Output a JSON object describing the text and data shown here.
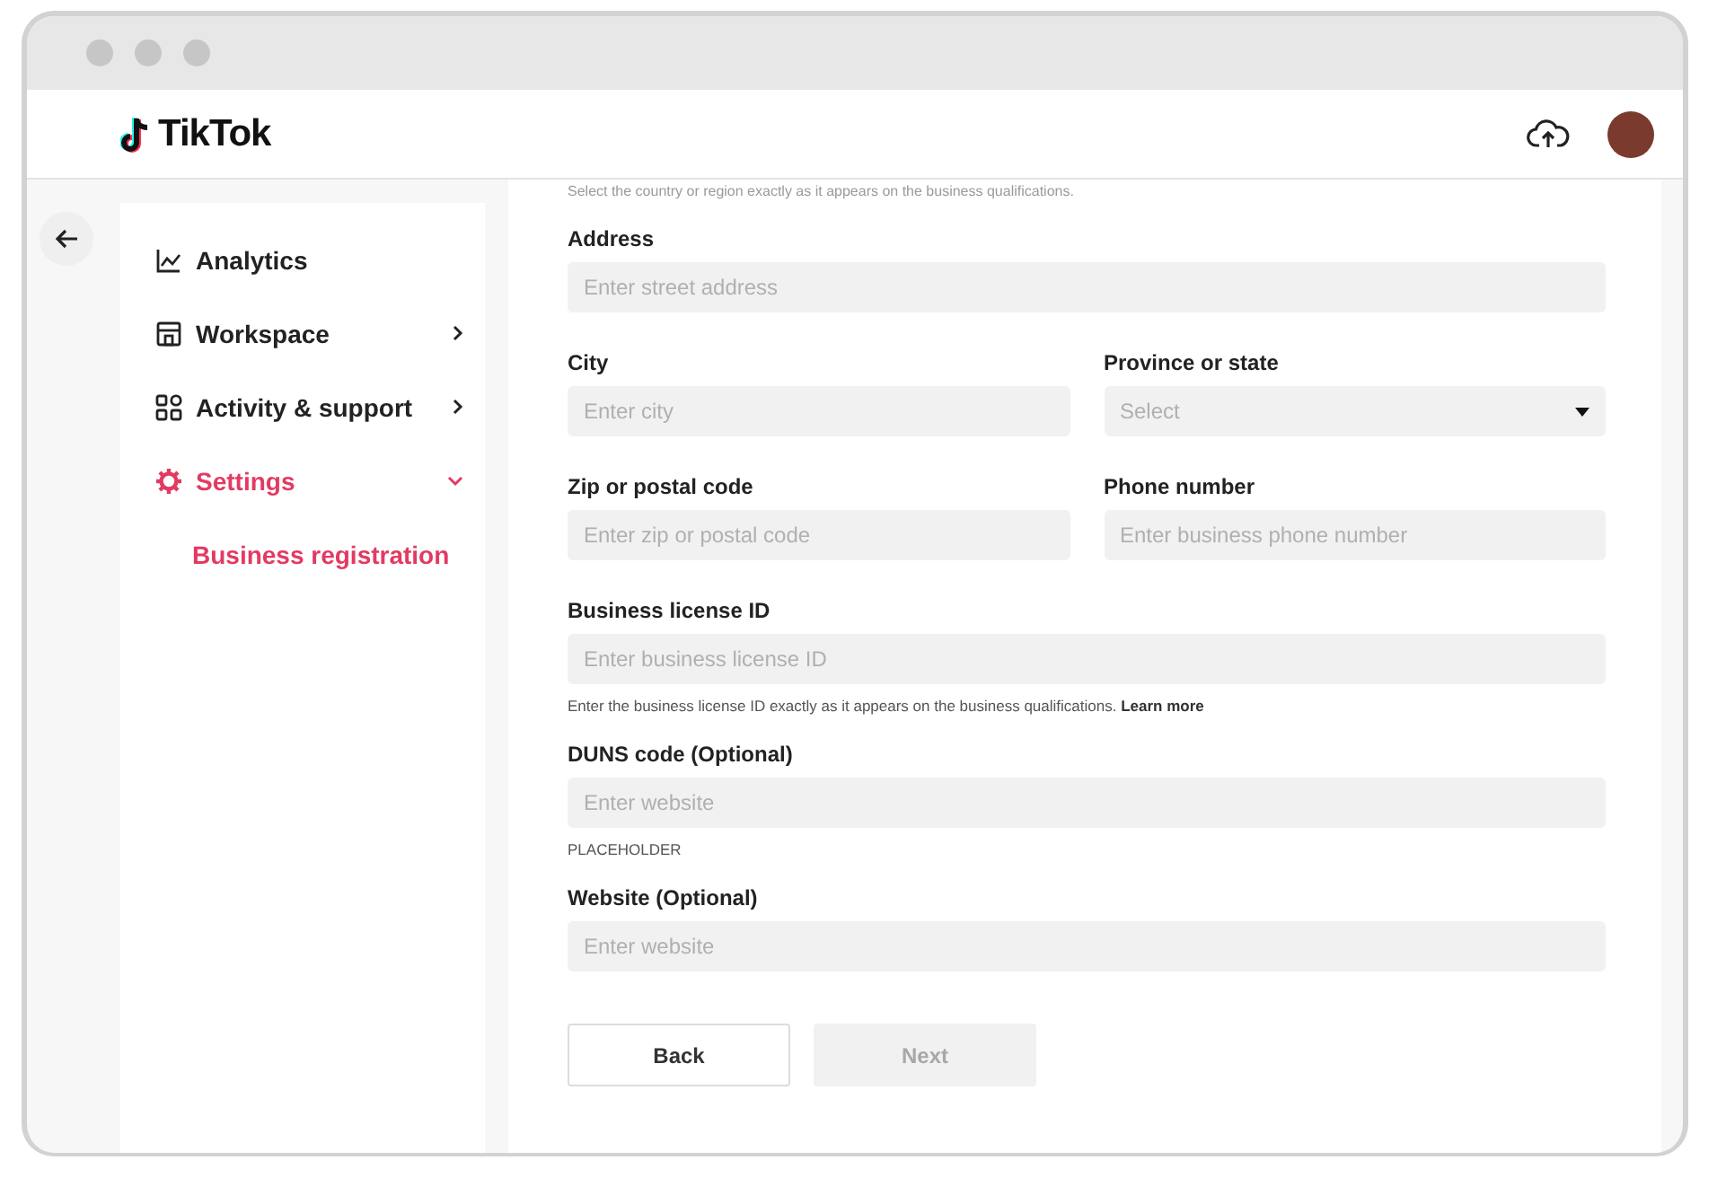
{
  "header": {
    "logo": "TikTok"
  },
  "sidebar": {
    "items": [
      {
        "label": "Analytics",
        "selected": false
      },
      {
        "label": "Workspace",
        "expanded": false,
        "selected": false
      },
      {
        "label": "Activity & support",
        "expanded": false,
        "selected": false
      },
      {
        "label": "Settings",
        "expanded": true,
        "selected": true,
        "children": [
          {
            "label": "Business registration",
            "selected": true
          }
        ]
      }
    ]
  },
  "form": {
    "top_hint": "Select the country or region exactly as it appears on the business qualifications.",
    "rows": [
      {
        "fields": [
          {
            "label": "Address",
            "kind": "text",
            "placeholder": "Enter street address"
          }
        ]
      },
      {
        "fields": [
          {
            "label": "City",
            "kind": "text",
            "placeholder": "Enter city"
          },
          {
            "label": "Province or state",
            "kind": "select",
            "placeholder": "Select"
          }
        ]
      },
      {
        "fields": [
          {
            "label": "Zip or postal code",
            "kind": "text",
            "placeholder": "Enter zip or postal code"
          },
          {
            "label": "Phone number",
            "kind": "text",
            "placeholder": "Enter business phone number"
          }
        ]
      },
      {
        "fields": [
          {
            "label": "Business license ID",
            "kind": "text",
            "placeholder": "Enter business license ID",
            "hint": "Enter the business license ID exactly as it appears on the business qualifications.",
            "hint_link": "Learn more"
          }
        ]
      },
      {
        "fields": [
          {
            "label": "DUNS code (Optional)",
            "kind": "text",
            "placeholder": "Enter website",
            "hint": "PLACEHOLDER"
          }
        ]
      },
      {
        "fields": [
          {
            "label": "Website (Optional)",
            "kind": "text",
            "placeholder": "Enter website"
          }
        ]
      }
    ],
    "buttons": [
      {
        "label": "Back",
        "disabled": false
      },
      {
        "label": "Next",
        "disabled": true
      }
    ]
  }
}
